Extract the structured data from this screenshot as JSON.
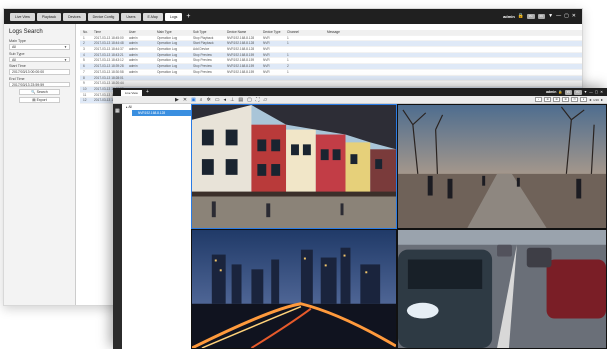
{
  "window1": {
    "tabs": [
      "Live View",
      "Playback",
      "Devices",
      "Device Config",
      "Users",
      "E-Map",
      "Logs"
    ],
    "active_tab": "Logs",
    "user": "admin",
    "right_labels": [
      "Pc",
      "Pc"
    ],
    "sidebar": {
      "title": "Logs Search",
      "main_type_label": "Main Type",
      "main_type_value": "All",
      "sub_type_label": "Sub Type",
      "sub_type_value": "All",
      "start_time_label": "Start Time",
      "start_time_value": "2017/03/13 00:00:00",
      "end_time_label": "End Time",
      "end_time_value": "2017/03/13 23:59:59",
      "search_label": "Search",
      "export_label": "Export"
    },
    "table": {
      "headers": [
        "No.",
        "Time",
        "User",
        "Main Type",
        "Sub Type",
        "Device Name",
        "Device Type",
        "Channel",
        "Message"
      ],
      "rows": [
        [
          "1",
          "2017-03-13 18:45:00",
          "admin",
          "Operation Log",
          "Stop Playback",
          "NVR192.168.8.128",
          "NVR",
          "1",
          ""
        ],
        [
          "2",
          "2017-03-13 18:44:48",
          "admin",
          "Operation Log",
          "Start Playback",
          "NVR192.168.8.128",
          "NVR",
          "1",
          ""
        ],
        [
          "3",
          "2017-03-13 18:44:37",
          "admin",
          "Operation Log",
          "Add Device",
          "NVR192.168.8.128",
          "NVR",
          "",
          ""
        ],
        [
          "4",
          "2017-03-13 18:43:21",
          "admin",
          "Operation Log",
          "Stop Preview",
          "NVR192.168.8.159",
          "NVR",
          "1",
          ""
        ],
        [
          "5",
          "2017-03-13 18:43:12",
          "admin",
          "Operation Log",
          "Stop Preview",
          "NVR192.168.8.159",
          "NVR",
          "1",
          ""
        ],
        [
          "6",
          "2017-03-13 18:39:28",
          "admin",
          "Operation Log",
          "Stop Preview",
          "NVR192.168.8.159",
          "NVR",
          "2",
          ""
        ],
        [
          "7",
          "2017-03-13 18:30:58",
          "admin",
          "Operation Log",
          "Stop Preview",
          "NVR192.168.8.159",
          "NVR",
          "1",
          ""
        ],
        [
          "8",
          "2017-03-13 18:28:01",
          "",
          "",
          "",
          "",
          "",
          "",
          ""
        ],
        [
          "9",
          "2017-03-13 18:20:44",
          "",
          "",
          "",
          "",
          "",
          "",
          ""
        ],
        [
          "10",
          "2017-03-13 18:15:33",
          "",
          "",
          "",
          "",
          "",
          "",
          ""
        ],
        [
          "11",
          "2017-03-13 18:10:02",
          "",
          "",
          "",
          "",
          "",
          "",
          ""
        ],
        [
          "12",
          "2017-03-13 18:05:47",
          "",
          "",
          "",
          "",
          "",
          "",
          ""
        ]
      ]
    }
  },
  "window2": {
    "tab": "Live View",
    "user": "admin",
    "right_labels": [
      "Pc",
      "Pc"
    ],
    "pager": "1/16",
    "tree": {
      "group": "All",
      "device": "NVR192.168.8.128"
    }
  },
  "colors": {
    "accent": "#2a7be4",
    "titlebar": "#202020",
    "row_highlight": "#dfe9f7"
  }
}
